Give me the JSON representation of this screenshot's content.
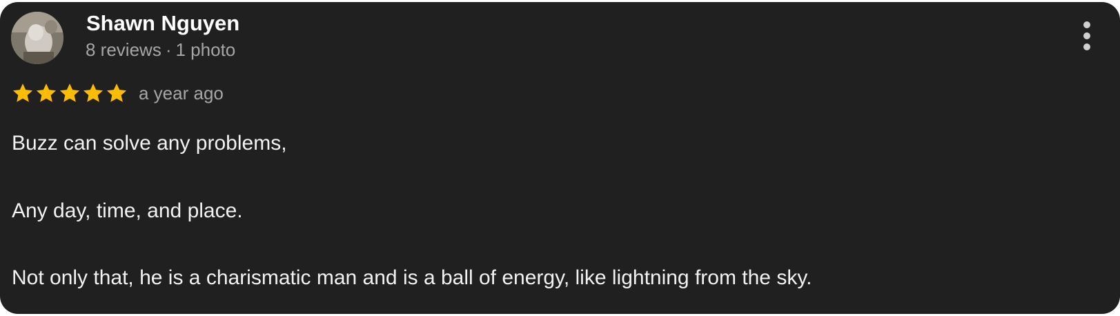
{
  "review": {
    "author": "Shawn Nguyen",
    "review_count": "8 reviews",
    "separator": "·",
    "photo_count": "1 photo",
    "rating": 5,
    "max_rating": 5,
    "date": "a year ago",
    "text_lines": [
      "Buzz can solve any problems,",
      "Any day, time, and place.",
      "Not only that, he is a charismatic man and is a ball of energy, like lightning from the sky."
    ]
  },
  "colors": {
    "card_background": "#202020",
    "star": "#fbbc04",
    "primary_text": "#ffffff",
    "secondary_text": "#a6a6a6"
  },
  "icons": {
    "avatar": "user-avatar-photo",
    "star": "star-icon",
    "menu": "more-vertical-icon"
  }
}
